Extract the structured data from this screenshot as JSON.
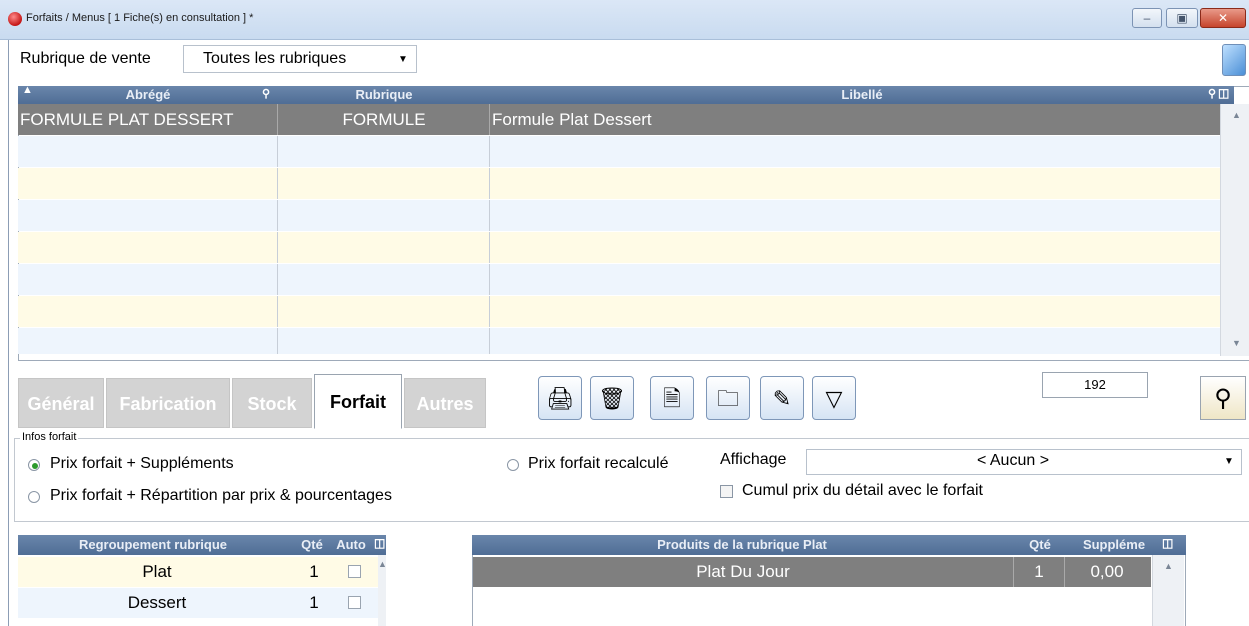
{
  "window": {
    "title": "Forfaits / Menus  [ 1 Fiche(s) en consultation ] *",
    "controls": [
      "minimize",
      "maximize",
      "close"
    ]
  },
  "filter": {
    "label": "Rubrique de vente",
    "selected": "Toutes les rubriques"
  },
  "main_grid": {
    "columns": [
      "Abrégé",
      "Rubrique",
      "Libellé"
    ],
    "rows": [
      {
        "abrege": "FORMULE PLAT DESSERT",
        "rubrique": "FORMULE",
        "libelle": "Formule Plat Dessert",
        "selected": true
      }
    ],
    "empty_rows": 7
  },
  "tabs": [
    "Général",
    "Fabrication",
    "Stock",
    "Forfait",
    "Autres"
  ],
  "active_tab": "Forfait",
  "toolbar": {
    "icons": [
      "printer-icon",
      "trash-icon",
      "new-document-icon",
      "folder-icon",
      "edit-folder-icon",
      "filter-icon"
    ],
    "count": "192"
  },
  "infos_forfait": {
    "legend": "Infos forfait",
    "option1": "Prix forfait + Suppléments",
    "option2": "Prix forfait + Répartition par prix & pourcentages",
    "option3": "Prix forfait recalculé",
    "affichage_label": "Affichage",
    "affichage_value": "< Aucun >",
    "cumul_label": "Cumul prix du détail avec le forfait"
  },
  "regroupement": {
    "columns": [
      "Regroupement rubrique",
      "Qté",
      "Auto"
    ],
    "rows": [
      {
        "name": "Plat",
        "qte": "1"
      },
      {
        "name": "Dessert",
        "qte": "1"
      }
    ]
  },
  "produits": {
    "columns": [
      "Produits de la rubrique Plat",
      "Qté",
      "Suppléme"
    ],
    "rows": [
      {
        "name": "Plat Du Jour",
        "qte": "1",
        "supplement": "0,00"
      }
    ]
  },
  "colors": {
    "header_blue": "#4f6d95",
    "selected_row": "#7f7f7f",
    "row_alt_yellow": "#fffbe6",
    "row_alt_blue": "#eef5fd"
  }
}
